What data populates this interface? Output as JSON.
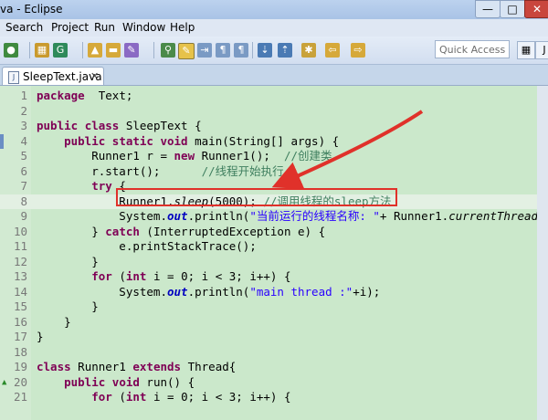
{
  "window": {
    "title": "va - Eclipse",
    "controls": {
      "minimize": "—",
      "maximize": "□",
      "close": "✕"
    }
  },
  "menu": [
    "Search",
    "Project",
    "Run",
    "Window",
    "Help"
  ],
  "toolbar": {
    "quick_access_placeholder": "Quick Access"
  },
  "editor_tab": {
    "label": "SleepText.java",
    "close": "✕",
    "file_icon": "J"
  },
  "code_lines": [
    {
      "num": "1",
      "tokens": [
        [
          "kw",
          "package"
        ],
        [
          "",
          "  Text;"
        ]
      ]
    },
    {
      "num": "2",
      "tokens": []
    },
    {
      "num": "3",
      "tokens": [
        [
          "kw",
          "public"
        ],
        [
          "",
          " "
        ],
        [
          "kw",
          "class"
        ],
        [
          "",
          " SleepText {"
        ]
      ]
    },
    {
      "num": "4",
      "tokens": [
        [
          "",
          "    "
        ],
        [
          "kw",
          "public"
        ],
        [
          "",
          " "
        ],
        [
          "kw",
          "static"
        ],
        [
          "",
          " "
        ],
        [
          "kw",
          "void"
        ],
        [
          "",
          " main(String[] args) {"
        ]
      ]
    },
    {
      "num": "5",
      "tokens": [
        [
          "",
          "        Runner1 r = "
        ],
        [
          "kw",
          "new"
        ],
        [
          "",
          " Runner1();  "
        ],
        [
          "cm",
          "//创建类"
        ]
      ]
    },
    {
      "num": "6",
      "tokens": [
        [
          "",
          "        r.start();      "
        ],
        [
          "cm",
          "//线程开始执行"
        ]
      ]
    },
    {
      "num": "7",
      "tokens": [
        [
          "",
          "        "
        ],
        [
          "kw",
          "try"
        ],
        [
          "",
          " {"
        ]
      ]
    },
    {
      "num": "8",
      "tokens": [
        [
          "",
          "            Runner1."
        ],
        [
          "it",
          "sleep"
        ],
        [
          "",
          "(5000); "
        ],
        [
          "cm",
          "//调用线程的sleep方法"
        ]
      ]
    },
    {
      "num": "9",
      "tokens": [
        [
          "",
          "            System."
        ],
        [
          "fi",
          "out"
        ],
        [
          "",
          ".println("
        ],
        [
          "st",
          "\"当前运行的线程名称: \""
        ],
        [
          "",
          "+ Runner1."
        ],
        [
          "it",
          "currentThread"
        ],
        [
          "",
          "()"
        ]
      ]
    },
    {
      "num": "10",
      "tokens": [
        [
          "",
          "        } "
        ],
        [
          "kw",
          "catch"
        ],
        [
          "",
          " (InterruptedException e) {"
        ]
      ]
    },
    {
      "num": "11",
      "tokens": [
        [
          "",
          "            e.printStackTrace();"
        ]
      ]
    },
    {
      "num": "12",
      "tokens": [
        [
          "",
          "        }"
        ]
      ]
    },
    {
      "num": "13",
      "tokens": [
        [
          "",
          "        "
        ],
        [
          "kw",
          "for"
        ],
        [
          "",
          " ("
        ],
        [
          "kw",
          "int"
        ],
        [
          "",
          " i = 0; i < 3; i++) {"
        ]
      ]
    },
    {
      "num": "14",
      "tokens": [
        [
          "",
          "            System."
        ],
        [
          "fi",
          "out"
        ],
        [
          "",
          ".println("
        ],
        [
          "st",
          "\"main thread :\""
        ],
        [
          "",
          "+i);"
        ]
      ]
    },
    {
      "num": "15",
      "tokens": [
        [
          "",
          "        }"
        ]
      ]
    },
    {
      "num": "16",
      "tokens": [
        [
          "",
          "    }"
        ]
      ]
    },
    {
      "num": "17",
      "tokens": [
        [
          "",
          "}"
        ]
      ]
    },
    {
      "num": "18",
      "tokens": []
    },
    {
      "num": "19",
      "tokens": [
        [
          "kw",
          "class"
        ],
        [
          "",
          " Runner1 "
        ],
        [
          "kw",
          "extends"
        ],
        [
          "",
          " Thread{"
        ]
      ]
    },
    {
      "num": "20",
      "tokens": [
        [
          "",
          "    "
        ],
        [
          "kw",
          "public"
        ],
        [
          "",
          " "
        ],
        [
          "kw",
          "void"
        ],
        [
          "",
          " run() {"
        ]
      ]
    },
    {
      "num": "21",
      "tokens": [
        [
          "",
          "        "
        ],
        [
          "kw",
          "for"
        ],
        [
          "",
          " ("
        ],
        [
          "kw",
          "int"
        ],
        [
          "",
          " i = 0; i < 3; i++) {"
        ]
      ]
    }
  ],
  "highlight": {
    "color": "#e0312a"
  }
}
